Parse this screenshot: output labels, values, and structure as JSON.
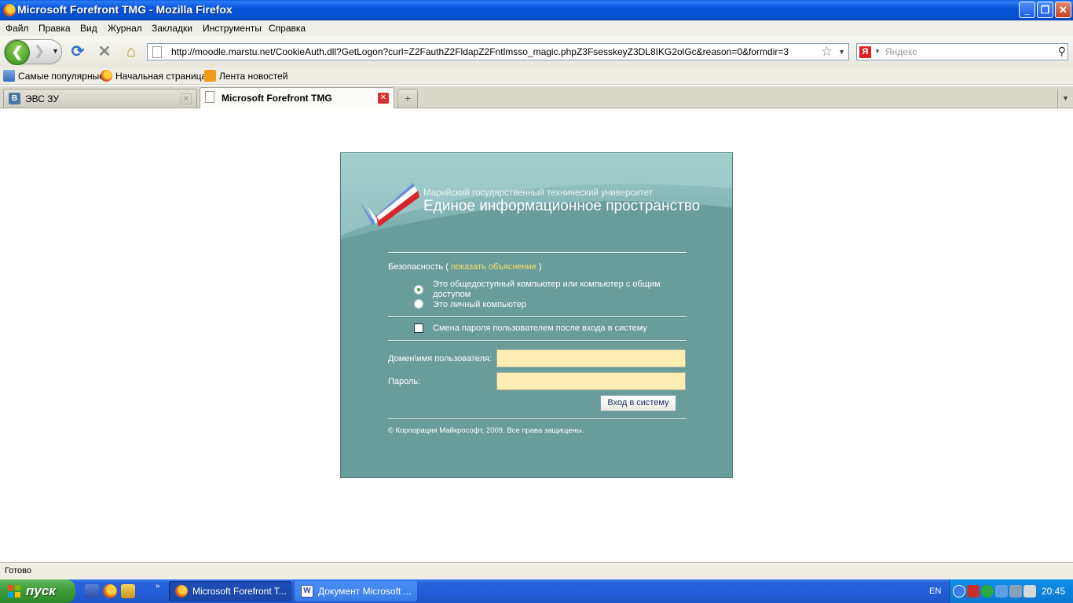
{
  "window": {
    "title": "Microsoft Forefront TMG - Mozilla Firefox",
    "minimize_label": "_",
    "maximize_label": "❐",
    "close_label": "✕"
  },
  "menu": [
    "Файл",
    "Правка",
    "Вид",
    "Журнал",
    "Закладки",
    "Инструменты",
    "Справка"
  ],
  "nav": {
    "url": "http://moodle.marstu.net/CookieAuth.dll?GetLogon?curl=Z2FauthZ2FldapZ2Fntlmsso_magic.phpZ3FsesskeyZ3DL8IKG2olGc&reason=0&formdir=3",
    "search_placeholder": "Яндекс",
    "search_engine_letter": "Я"
  },
  "bookmarks": [
    "Самые популярные",
    "Начальная страница",
    "Лента новостей"
  ],
  "tabs": [
    {
      "label": "ЭВС ЗУ",
      "active": false
    },
    {
      "label": "Microsoft Forefront TMG",
      "active": true
    }
  ],
  "login": {
    "university": "Марийский государственный технический университет",
    "system_title": "Единое информационное пространство",
    "security_label": "Безопасность (",
    "security_link": "показать объяснение",
    "security_close": ")",
    "option_public_line1": "Это общедоступный компьютер или компьютер с общим",
    "option_public_line2": "доступом",
    "option_private": "Это личный компьютер",
    "change_password": "Смена пароля пользователем после входа в систему",
    "username_label": "Домен\\имя пользователя:",
    "password_label": "Пароль:",
    "login_button": "Вход в систему",
    "copyright": "© Корпорация Майкрософт, 2009. Все права защищены."
  },
  "status": "Готово",
  "taskbar": {
    "start": "пуск",
    "more": "»",
    "tasks": [
      "Microsoft Forefront T...",
      "Документ Microsoft ..."
    ],
    "lang": "EN",
    "time": "20:45"
  }
}
